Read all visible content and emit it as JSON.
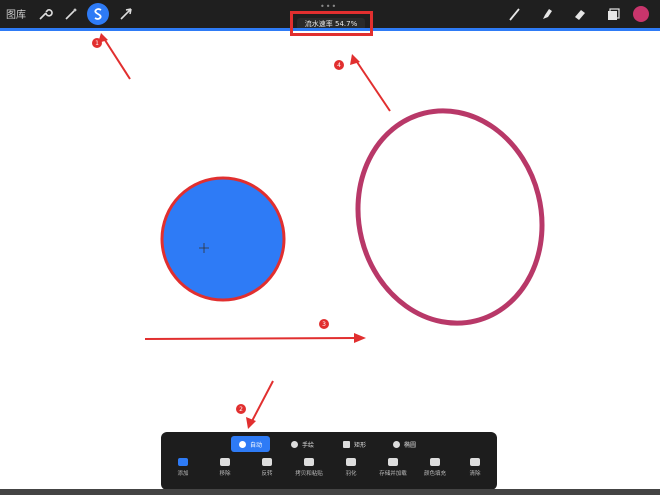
{
  "topbar": {
    "gallery_label": "图库",
    "left_tools": [
      {
        "name": "wrench-icon",
        "active": false
      },
      {
        "name": "magic-wand-icon",
        "active": false
      },
      {
        "name": "selection-s-icon",
        "active": true
      },
      {
        "name": "move-arrow-icon",
        "active": false
      }
    ],
    "right_tools": [
      {
        "name": "brush-icon"
      },
      {
        "name": "smudge-icon"
      },
      {
        "name": "eraser-icon"
      },
      {
        "name": "layers-icon"
      }
    ],
    "current_color": "#c8356c",
    "status_banner": "流水速率 54.7%"
  },
  "annotations": [
    {
      "number": "1"
    },
    {
      "number": "2"
    },
    {
      "number": "3"
    },
    {
      "number": "4"
    }
  ],
  "mode_bar": {
    "modes": [
      {
        "label": "自动",
        "active": true
      },
      {
        "label": "手绘",
        "active": false
      },
      {
        "label": "矩形",
        "active": false
      },
      {
        "label": "椭圆",
        "active": false
      }
    ]
  },
  "selection_tools": [
    {
      "label": "添加",
      "active": true
    },
    {
      "label": "移除",
      "active": false
    },
    {
      "label": "反转",
      "active": false
    },
    {
      "label": "拷贝和粘贴",
      "active": false
    },
    {
      "label": "羽化",
      "active": false
    },
    {
      "label": "存储并加载",
      "active": false
    },
    {
      "label": "颜色填充",
      "active": false
    },
    {
      "label": "清除",
      "active": false
    }
  ],
  "colors": {
    "accent_blue": "#2e7bf6",
    "annotation_red": "#e12f2f",
    "ellipse_stroke": "#b83868"
  }
}
